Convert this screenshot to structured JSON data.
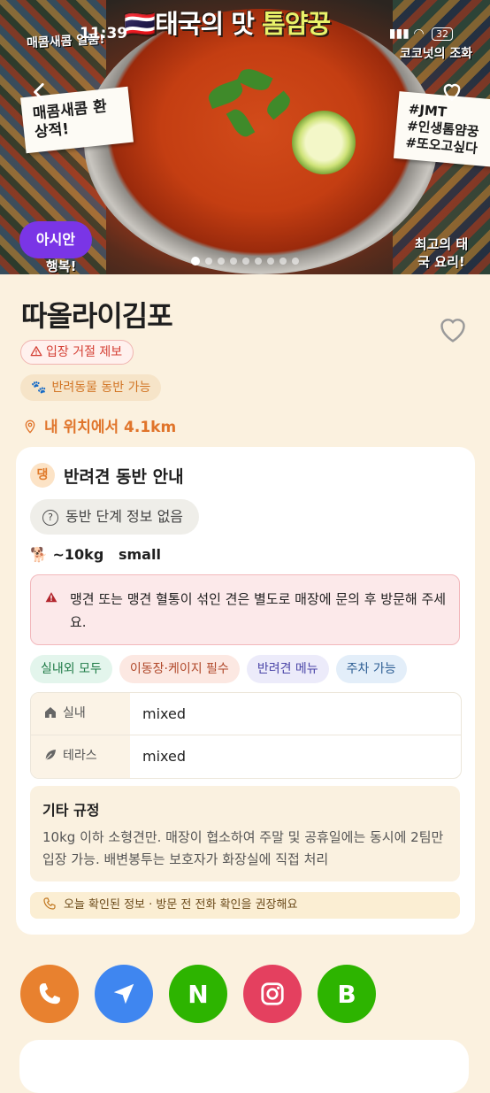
{
  "status_bar": {
    "time": "11:39",
    "battery": "32"
  },
  "hero": {
    "title_prefix": "태국의 맛 ",
    "title_accent": "톰얌꿍",
    "flag": "🇹🇭",
    "top_left_caption": "매콤새콤 일품!",
    "top_right_caption": "코코넛의 조화",
    "note_left": "매콤새콤 환상적!",
    "note_right_lines": [
      "#JMT",
      "#인생톰얌꿍",
      "#또오고싶다"
    ],
    "bottom_left_caption": "행복!",
    "bottom_right_caption": "최고의 태국 요리!",
    "category_badge": "아시안",
    "slide_count": 9,
    "active_slide": 1
  },
  "place": {
    "name": "따올라이김포",
    "report_chip": "입장 거절 제보",
    "pet_chip": "반려동물 동반 가능",
    "distance": "내 위치에서 4.1km"
  },
  "pet_card": {
    "badge": "댕",
    "title": "반려견 동반 안내",
    "stage": "동반 단계 정보 없음",
    "size": "~10kg   small",
    "warning": "맹견 또는 맹견 혈통이 섞인 견은 별도로 매장에 문의 후 방문해 주세요.",
    "tags": [
      "실내외 모두",
      "이동장·케이지 필수",
      "반려견 메뉴",
      "주차 가능"
    ],
    "table": [
      {
        "key": "실내",
        "value": "mixed"
      },
      {
        "key": "테라스",
        "value": "mixed"
      }
    ],
    "rules_title": "기타 규정",
    "rules_body": "10kg 이하 소형견만. 매장이 협소하여 주말 및 공휴일에는 동시에 2팀만 입장 가능. 배변봉투는 보호자가 화장실에 직접 처리",
    "notice": "오늘 확인된 정보 · 방문 전 전화 확인을 권장해요"
  },
  "actions": {
    "naver_label": "N",
    "blog_label": "B",
    "colors": {
      "phone": "#E8812F",
      "nav": "#3F86F0",
      "naver": "#2DB400",
      "instagram": "#E4405F",
      "blog": "#2DB400"
    }
  }
}
